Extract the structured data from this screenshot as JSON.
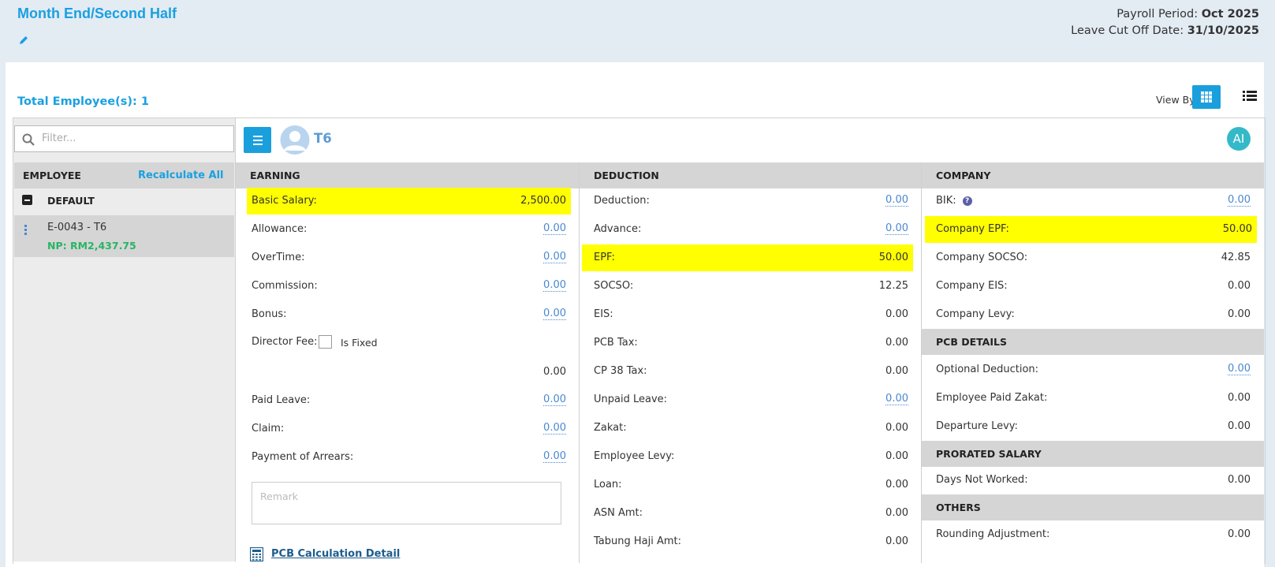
{
  "header": {
    "title": "Month End/Second Half",
    "payroll_period_label": "Payroll Period: ",
    "payroll_period_value": "Oct 2025",
    "leave_cutoff_label": "Leave Cut Off Date: ",
    "leave_cutoff_value": "31/10/2025"
  },
  "toolbar": {
    "total_employees": "Total Employee(s): 1",
    "view_by_label": "View By :",
    "view_modes": [
      "grid-icon",
      "list-icon"
    ]
  },
  "sidebar": {
    "filter_placeholder": "Filter...",
    "employee_header": "EMPLOYEE",
    "recalculate_label": "Recalculate All",
    "group": "DEFAULT",
    "employees": [
      {
        "id": "E-0043 - T6",
        "net_pay": "NP: RM2,437.75"
      }
    ]
  },
  "employee": {
    "name": "T6",
    "ai_badge": "AI"
  },
  "earning": {
    "title": "EARNING",
    "rows": [
      {
        "label": "Basic Salary:",
        "value": "2,500.00"
      },
      {
        "label": "Allowance:",
        "value": "0.00"
      },
      {
        "label": "OverTime:",
        "value": "0.00"
      },
      {
        "label": "Commission:",
        "value": "0.00"
      },
      {
        "label": "Bonus:",
        "value": "0.00"
      }
    ],
    "director_fee_label": "Director Fee:",
    "is_fixed_label": "Is Fixed",
    "director_fee_value": "0.00",
    "rows2": [
      {
        "label": "Paid Leave:",
        "value": "0.00"
      },
      {
        "label": "Claim:",
        "value": "0.00"
      },
      {
        "label": "Payment of Arrears:",
        "value": "0.00"
      }
    ],
    "remark_placeholder": "Remark",
    "pcb_link": "PCB Calculation Detail"
  },
  "deduction": {
    "title": "DEDUCTION",
    "rows": [
      {
        "label": "Deduction:",
        "value": "0.00"
      },
      {
        "label": "Advance:",
        "value": "0.00"
      },
      {
        "label": "EPF:",
        "value": "50.00"
      },
      {
        "label": "SOCSO:",
        "value": "12.25"
      },
      {
        "label": "EIS:",
        "value": "0.00"
      },
      {
        "label": "PCB Tax:",
        "value": "0.00"
      },
      {
        "label": "CP 38 Tax:",
        "value": "0.00"
      },
      {
        "label": "Unpaid Leave:",
        "value": "0.00"
      },
      {
        "label": "Zakat:",
        "value": "0.00"
      },
      {
        "label": "Employee Levy:",
        "value": "0.00"
      },
      {
        "label": "Loan:",
        "value": "0.00"
      },
      {
        "label": "ASN Amt:",
        "value": "0.00"
      },
      {
        "label": "Tabung Haji Amt:",
        "value": "0.00"
      }
    ]
  },
  "company": {
    "title": "COMPANY",
    "rows": [
      {
        "label": "BIK:",
        "value": "0.00"
      },
      {
        "label": "Company EPF:",
        "value": "50.00"
      },
      {
        "label": "Company SOCSO:",
        "value": "42.85"
      },
      {
        "label": "Company EIS:",
        "value": "0.00"
      },
      {
        "label": "Company Levy:",
        "value": "0.00"
      }
    ],
    "pcb_title": "PCB DETAILS",
    "pcb_rows": [
      {
        "label": "Optional Deduction:",
        "value": "0.00"
      },
      {
        "label": "Employee Paid Zakat:",
        "value": "0.00"
      },
      {
        "label": "Departure Levy:",
        "value": "0.00"
      }
    ],
    "prorated_title": "PRORATED SALARY",
    "prorated_rows": [
      {
        "label": "Days Not Worked:",
        "value": "0.00"
      }
    ],
    "others_title": "OTHERS",
    "others_rows": [
      {
        "label": "Rounding Adjustment:",
        "value": "0.00"
      }
    ]
  },
  "colors": {
    "accent": "#1aa0e0",
    "highlight": "#ffff00",
    "net_pay": "#26b565"
  }
}
